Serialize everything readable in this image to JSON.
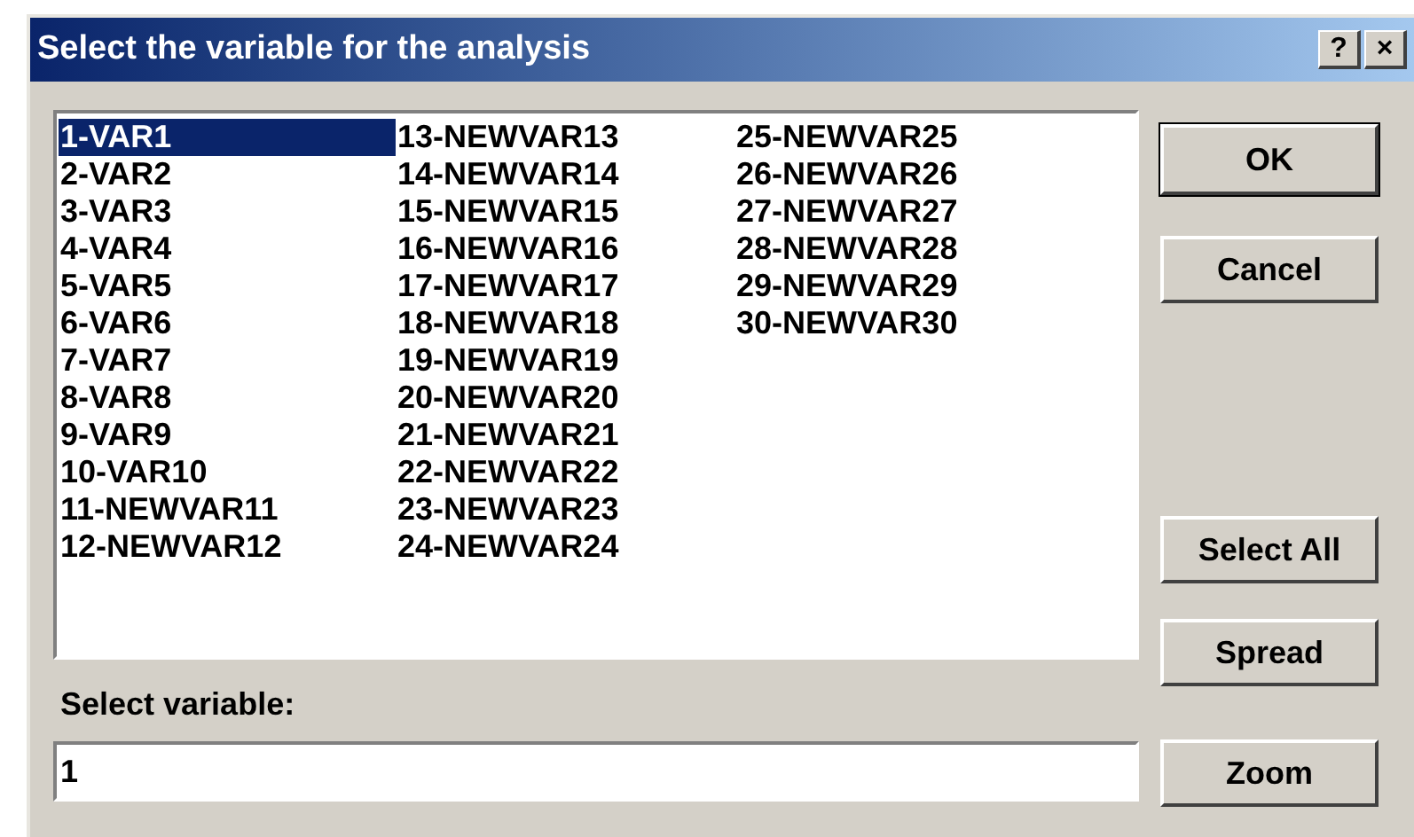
{
  "window": {
    "title": "Select the variable for the analysis",
    "title_buttons": [
      "?",
      "×"
    ]
  },
  "variables": [
    {
      "label": "1-VAR1",
      "selected": true
    },
    {
      "label": "2-VAR2",
      "selected": false
    },
    {
      "label": "3-VAR3",
      "selected": false
    },
    {
      "label": "4-VAR4",
      "selected": false
    },
    {
      "label": "5-VAR5",
      "selected": false
    },
    {
      "label": "6-VAR6",
      "selected": false
    },
    {
      "label": "7-VAR7",
      "selected": false
    },
    {
      "label": "8-VAR8",
      "selected": false
    },
    {
      "label": "9-VAR9",
      "selected": false
    },
    {
      "label": "10-VAR10",
      "selected": false
    },
    {
      "label": "11-NEWVAR11",
      "selected": false
    },
    {
      "label": "12-NEWVAR12",
      "selected": false
    },
    {
      "label": "13-NEWVAR13",
      "selected": false
    },
    {
      "label": "14-NEWVAR14",
      "selected": false
    },
    {
      "label": "15-NEWVAR15",
      "selected": false
    },
    {
      "label": "16-NEWVAR16",
      "selected": false
    },
    {
      "label": "17-NEWVAR17",
      "selected": false
    },
    {
      "label": "18-NEWVAR18",
      "selected": false
    },
    {
      "label": "19-NEWVAR19",
      "selected": false
    },
    {
      "label": "20-NEWVAR20",
      "selected": false
    },
    {
      "label": "21-NEWVAR21",
      "selected": false
    },
    {
      "label": "22-NEWVAR22",
      "selected": false
    },
    {
      "label": "23-NEWVAR23",
      "selected": false
    },
    {
      "label": "24-NEWVAR24",
      "selected": false
    },
    {
      "label": "25-NEWVAR25",
      "selected": false
    },
    {
      "label": "26-NEWVAR26",
      "selected": false
    },
    {
      "label": "27-NEWVAR27",
      "selected": false
    },
    {
      "label": "28-NEWVAR28",
      "selected": false
    },
    {
      "label": "29-NEWVAR29",
      "selected": false
    },
    {
      "label": "30-NEWVAR30",
      "selected": false
    }
  ],
  "select_variable": {
    "label": "Select variable:",
    "value": "1"
  },
  "buttons": [
    {
      "label": "OK",
      "default": true
    },
    {
      "label": "Cancel",
      "default": false
    },
    {
      "label": "Select All",
      "default": false
    },
    {
      "label": "Spread",
      "default": false
    },
    {
      "label": "Zoom",
      "default": false
    }
  ]
}
